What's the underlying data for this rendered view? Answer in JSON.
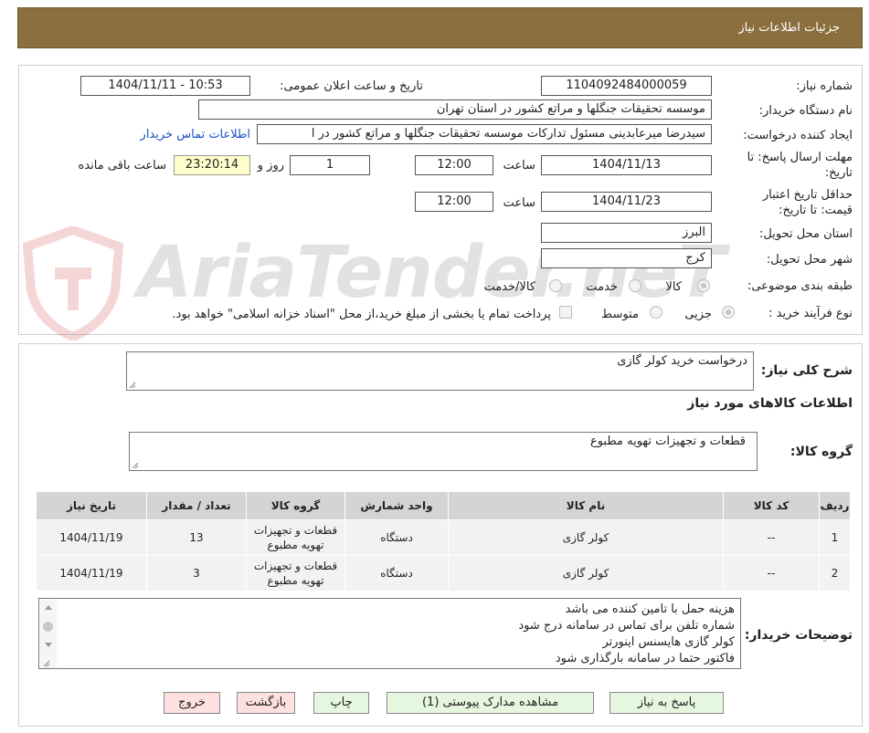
{
  "header": {
    "title": "جزئيات اطلاعات نیاز"
  },
  "form": {
    "need_number_label": "شماره نیاز:",
    "need_number": "1104092484000059",
    "announce_label": "تاریخ و ساعت اعلان عمومی:",
    "announce_value": "1404/11/11 - 10:53",
    "buyer_org_label": "نام دستگاه خریدار:",
    "buyer_org": "موسسه تحقیقات جنگلها و مراتع کشور در استان تهران",
    "creator_label": "ایجاد کننده درخواست:",
    "creator": "سیدرضا میرعابدینی مسئول تداركات موسسه تحقیقات جنگلها و مراتع کشور در ا",
    "contact_link": "اطلاعات تماس خریدار",
    "deadline_label": "مهلت ارسال پاسخ: تا تاریخ:",
    "deadline_date": "1404/11/13",
    "hour_label": "ساعت",
    "deadline_hour": "12:00",
    "days_value": "1",
    "days_label": "روز و",
    "remaining_time": "23:20:14",
    "remaining_label": "ساعت باقی مانده",
    "validity_label": "حداقل تاریخ اعتبار قیمت: تا تاریخ:",
    "validity_date": "1404/11/23",
    "validity_hour": "12:00",
    "province_label": "استان محل تحویل:",
    "province": "البرز",
    "city_label": "شهر محل تحویل:",
    "city": "کرج",
    "category_label": "طبقه بندی موضوعی:",
    "category_options": [
      "کالا",
      "خدمت",
      "کالا/خدمت"
    ],
    "process_label": "نوع فرآیند خرید :",
    "process_options": [
      "جزیی",
      "متوسط"
    ],
    "treasury_note": "پرداخت تمام یا بخشی از مبلغ خرید،از محل \"اسناد خزانه اسلامی\" خواهد بود."
  },
  "watermark": {
    "text": "AriaTender.neT"
  },
  "description": {
    "label": "شرح کلی نیاز:",
    "value": "درخواست خرید کولر گازی"
  },
  "goods": {
    "section_title": "اطلاعات کالاهای مورد نیاز",
    "group_label": "گروه کالا:",
    "group_value": "قطعات و تجهیزات تهویه مطبوع",
    "columns": [
      "ردیف",
      "کد کالا",
      "نام کالا",
      "واحد شمارش",
      "گروه کالا",
      "تعداد / مقدار",
      "تاریخ نیاز"
    ],
    "rows": [
      {
        "row": "1",
        "code": "--",
        "name": "کولر گازی",
        "unit": "دستگاه",
        "group_l1": "قطعات و تجهیزات",
        "group_l2": "تهویه مطبوع",
        "qty": "13",
        "date": "1404/11/19"
      },
      {
        "row": "2",
        "code": "--",
        "name": "کولر گازی",
        "unit": "دستگاه",
        "group_l1": "قطعات و تجهیزات",
        "group_l2": "تهویه مطبوع",
        "qty": "3",
        "date": "1404/11/19"
      }
    ]
  },
  "notes": {
    "label": "توضیحات خریدار:",
    "lines": [
      "هزینه حمل با تامین کننده می باشد",
      "شماره تلفن برای تماس در سامانه درج شود",
      "کولر گازی هایسنس اینورتر",
      "فاکتور حتما در سامانه بارگذاری شود"
    ]
  },
  "buttons": {
    "reply": "پاسخ به نیاز",
    "attachments": "مشاهده مدارک پیوستی (1)",
    "print": "چاپ",
    "back": "بازگشت",
    "exit": "خروج"
  }
}
